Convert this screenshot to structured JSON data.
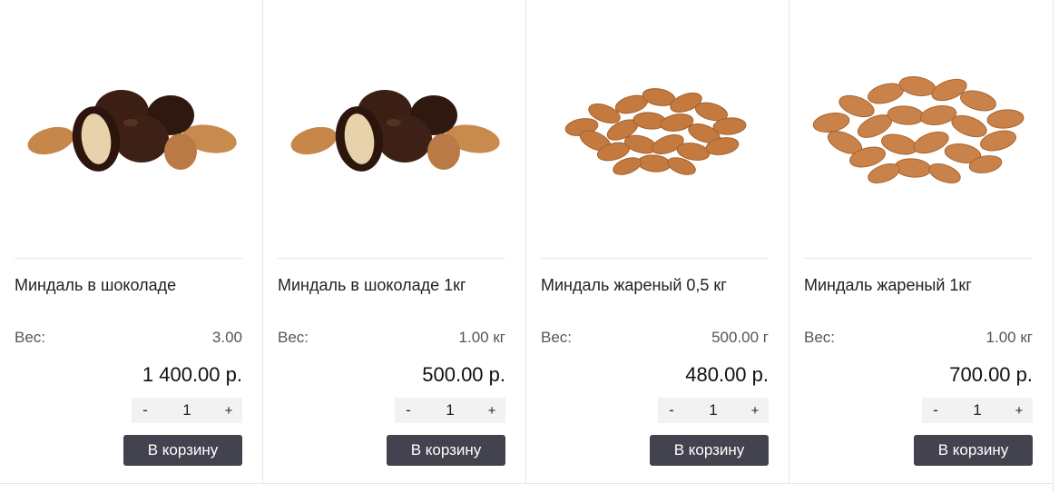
{
  "products": [
    {
      "name": "Миндаль в шоколаде",
      "weight_label": "Вес:",
      "weight_value": "3.00",
      "price": "1 400.00 р.",
      "quantity": "1",
      "minus": "-",
      "plus": "+",
      "cart_label": "В корзину",
      "image_icon": "chocolate-almonds-image"
    },
    {
      "name": "Миндаль в шоколаде 1кг",
      "weight_label": "Вес:",
      "weight_value": "1.00 кг",
      "price": "500.00 р.",
      "quantity": "1",
      "minus": "-",
      "plus": "+",
      "cart_label": "В корзину",
      "image_icon": "chocolate-almonds-image"
    },
    {
      "name": "Миндаль жареный 0,5 кг",
      "weight_label": "Вес:",
      "weight_value": "500.00 г",
      "price": "480.00 р.",
      "quantity": "1",
      "minus": "-",
      "plus": "+",
      "cart_label": "В корзину",
      "image_icon": "roasted-almonds-image"
    },
    {
      "name": "Миндаль жареный 1кг",
      "weight_label": "Вес:",
      "weight_value": "1.00 кг",
      "price": "700.00 р.",
      "quantity": "1",
      "minus": "-",
      "plus": "+",
      "cart_label": "В корзину",
      "image_icon": "roasted-almonds-image"
    }
  ],
  "colors": {
    "button_bg": "#434350",
    "button_text": "#ffffff",
    "qty_bg": "#f2f2f2",
    "almond": "#c47a3f",
    "chocolate": "#3a1f14"
  }
}
